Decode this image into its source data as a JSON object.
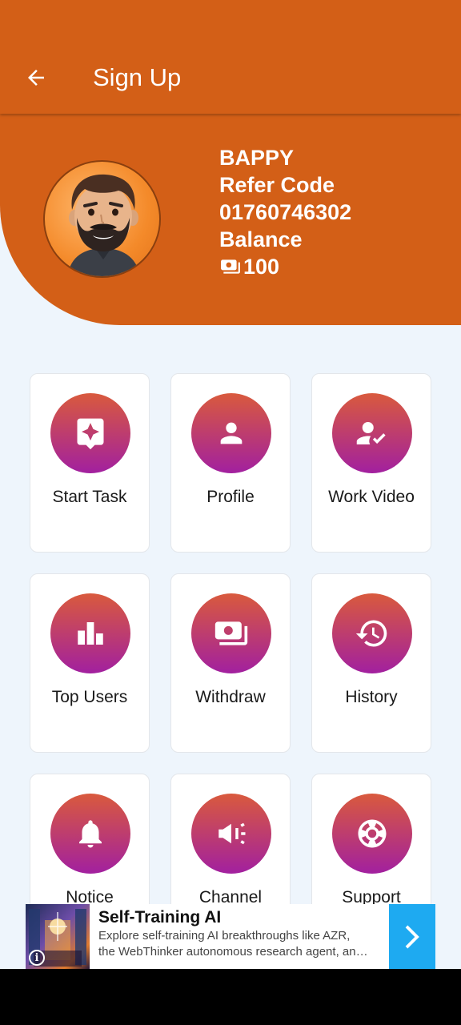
{
  "appbar": {
    "title": "Sign Up",
    "back_icon": "arrow-left-icon"
  },
  "user": {
    "name": "BAPPY",
    "refer_label": "Refer Code",
    "refer_code": "01760746302",
    "balance_label": "Balance",
    "balance_value": "100",
    "balance_icon": "money-icon"
  },
  "menu": [
    {
      "label": "Start Task",
      "icon": "task-icon"
    },
    {
      "label": "Profile",
      "icon": "person-icon"
    },
    {
      "label": "Work Video",
      "icon": "person-check-icon"
    },
    {
      "label": "Top Users",
      "icon": "bar-chart-icon"
    },
    {
      "label": "Withdraw",
      "icon": "money-icon"
    },
    {
      "label": "History",
      "icon": "history-icon"
    },
    {
      "label": "Notice",
      "icon": "bell-icon"
    },
    {
      "label": "Channel",
      "icon": "megaphone-icon"
    },
    {
      "label": "Support",
      "icon": "lifebuoy-icon"
    }
  ],
  "ad": {
    "title": "Self-Training AI",
    "desc_line1": "Explore self-training AI breakthroughs like AZR,",
    "desc_line2": "the WebThinker autonomous research agent, an…",
    "info": "i",
    "cta_icon": "chevron-right-icon"
  },
  "colors": {
    "primary": "#d35f17",
    "gradient_top": "#d95a3d",
    "gradient_bottom": "#a2209f",
    "background": "#eef5fc",
    "ad_cta": "#1eaaf1"
  }
}
